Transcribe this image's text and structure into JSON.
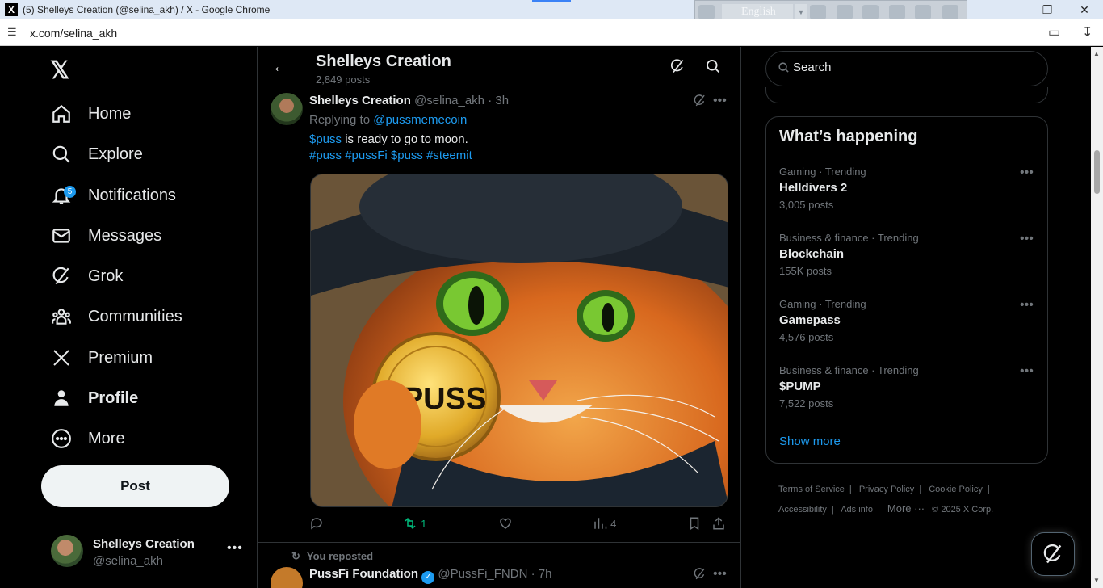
{
  "browser": {
    "window_title": "(5) Shelleys Creation (@selina_akh) / X - Google Chrome",
    "url": "x.com/selina_akh",
    "language": "English"
  },
  "nav": {
    "items": [
      {
        "label": "Home",
        "icon": "home-icon"
      },
      {
        "label": "Explore",
        "icon": "search-icon"
      },
      {
        "label": "Notifications",
        "icon": "bell-icon",
        "badge": "5"
      },
      {
        "label": "Messages",
        "icon": "mail-icon"
      },
      {
        "label": "Grok",
        "icon": "grok-icon"
      },
      {
        "label": "Communities",
        "icon": "people-icon"
      },
      {
        "label": "Premium",
        "icon": "x-logo-icon"
      },
      {
        "label": "Profile",
        "icon": "person-icon"
      },
      {
        "label": "More",
        "icon": "more-circle-icon"
      }
    ],
    "post_button": "Post",
    "account": {
      "name": "Shelleys Creation",
      "handle": "@selina_akh"
    }
  },
  "header": {
    "name": "Shelleys Creation",
    "post_count": "2,849 posts"
  },
  "tweet": {
    "author": "Shelleys Creation",
    "handle": "@selina_akh",
    "time": "· 3h",
    "replying_prefix": "Replying to ",
    "replying_to": "@pussmemecoin",
    "text_cashtag": "$puss",
    "text_rest": " is ready to go to moon.",
    "hashtags": "#puss #pussFi $puss #steemit",
    "coin_text": "$PUSS",
    "retweets": "1",
    "views": "4"
  },
  "tweet2": {
    "repost_label": "You reposted",
    "author": "PussFi Foundation",
    "handle": "@PussFi_FNDN",
    "time": "· 7h"
  },
  "search": {
    "placeholder": "Search"
  },
  "trends": {
    "title": "What’s happening",
    "items": [
      {
        "category": "Gaming · Trending",
        "name": "Helldivers 2",
        "count": "3,005 posts"
      },
      {
        "category": "Business & finance · Trending",
        "name": "Blockchain",
        "count": "155K posts"
      },
      {
        "category": "Gaming · Trending",
        "name": "Gamepass",
        "count": "4,576 posts"
      },
      {
        "category": "Business & finance · Trending",
        "name": "$PUMP",
        "count": "7,522 posts"
      }
    ],
    "show_more": "Show more"
  },
  "footer": {
    "terms": "Terms of Service",
    "privacy": "Privacy Policy",
    "cookie": "Cookie Policy",
    "accessibility": "Accessibility",
    "ads": "Ads info",
    "more": "More ···",
    "copyright": "© 2025 X Corp."
  },
  "colors": {
    "accent": "#1d9bf0",
    "retweet": "#00ba7c",
    "background": "#000000"
  }
}
